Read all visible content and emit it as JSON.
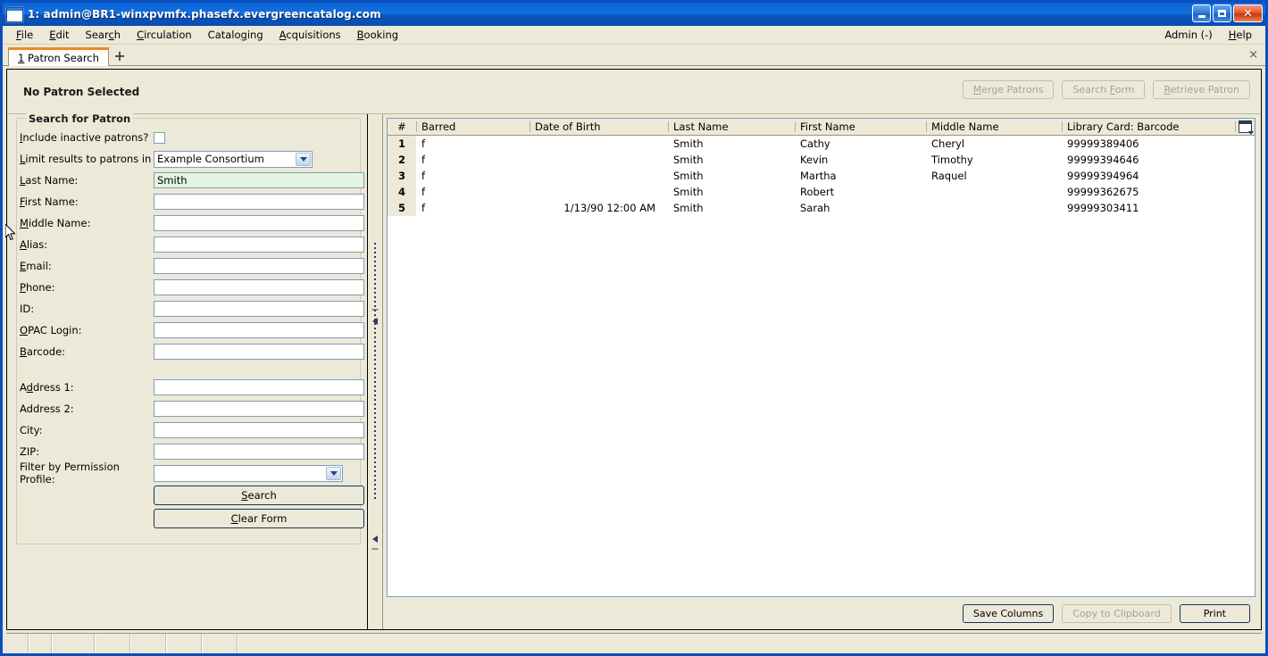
{
  "window": {
    "title": "1: admin@BR1-winxpvmfx.phasefx.evergreencatalog.com",
    "icon": "window-icon",
    "controls": {
      "minimize": "minimize",
      "maximize": "maximize",
      "close": "close"
    }
  },
  "menubar": {
    "items": [
      {
        "label": "File",
        "accel": "F"
      },
      {
        "label": "Edit",
        "accel": "E"
      },
      {
        "label": "Search",
        "accel": "c"
      },
      {
        "label": "Circulation",
        "accel": "C"
      },
      {
        "label": "Cataloging",
        "accel": "g"
      },
      {
        "label": "Acquisitions",
        "accel": "A"
      },
      {
        "label": "Booking",
        "accel": "B"
      }
    ],
    "right": [
      {
        "label": "Admin (-)",
        "accel": ""
      },
      {
        "label": "Help",
        "accel": "H"
      }
    ]
  },
  "tabbar": {
    "tabs": [
      {
        "number": "1",
        "label": "Patron Search",
        "active": true
      }
    ],
    "new_tab_label": "+",
    "close_label": "×"
  },
  "patron_header": {
    "title": "No Patron Selected",
    "buttons": [
      {
        "label": "Merge Patrons",
        "accel": "M",
        "disabled": true
      },
      {
        "label": "Search Form",
        "accel": "F",
        "disabled": true
      },
      {
        "label": "Retrieve Patron",
        "accel": "R",
        "disabled": true
      }
    ]
  },
  "search_form": {
    "legend": "Search for Patron",
    "fields": [
      {
        "name": "include-inactive",
        "label": "Include inactive patrons?",
        "accel": "I",
        "type": "checkbox",
        "checked": false
      },
      {
        "name": "limit-org",
        "label": "Limit results to patrons in",
        "accel": "L",
        "type": "select",
        "value": "Example Consortium"
      },
      {
        "name": "last-name",
        "label": "Last Name:",
        "accel": "L",
        "type": "text",
        "value": "Smith",
        "focused": true
      },
      {
        "name": "first-name",
        "label": "First Name:",
        "accel": "F",
        "type": "text",
        "value": ""
      },
      {
        "name": "middle-name",
        "label": "Middle Name:",
        "accel": "M",
        "type": "text",
        "value": ""
      },
      {
        "name": "alias",
        "label": "Alias:",
        "accel": "A",
        "type": "text",
        "value": ""
      },
      {
        "name": "email",
        "label": "Email:",
        "accel": "E",
        "type": "text",
        "value": ""
      },
      {
        "name": "phone",
        "label": "Phone:",
        "accel": "P",
        "type": "text",
        "value": ""
      },
      {
        "name": "id",
        "label": "ID:",
        "accel": "",
        "type": "text",
        "value": ""
      },
      {
        "name": "opac-login",
        "label": "OPAC Login:",
        "accel": "O",
        "type": "text",
        "value": ""
      },
      {
        "name": "barcode",
        "label": "Barcode:",
        "accel": "B",
        "type": "text",
        "value": ""
      },
      {
        "name": "address-1",
        "label": "Address 1:",
        "accel": "d",
        "type": "text",
        "value": "",
        "spaced": true
      },
      {
        "name": "address-2",
        "label": "Address 2:",
        "accel": "",
        "type": "text",
        "value": ""
      },
      {
        "name": "city",
        "label": "City:",
        "accel": "",
        "type": "text",
        "value": ""
      },
      {
        "name": "zip",
        "label": "ZIP:",
        "accel": "",
        "type": "text",
        "value": ""
      },
      {
        "name": "permission-profile",
        "label": "Filter by Permission Profile:",
        "accel": "",
        "type": "select",
        "value": ""
      }
    ],
    "buttons": [
      {
        "name": "search-button",
        "label": "Search",
        "accel": "S"
      },
      {
        "name": "clear-form-button",
        "label": "Clear Form",
        "accel": "C"
      }
    ]
  },
  "results": {
    "columns": [
      {
        "key": "num",
        "label": "#"
      },
      {
        "key": "barred",
        "label": "Barred"
      },
      {
        "key": "dob",
        "label": "Date of Birth"
      },
      {
        "key": "last_name",
        "label": "Last Name"
      },
      {
        "key": "first_name",
        "label": "First Name"
      },
      {
        "key": "middle_name",
        "label": "Middle Name"
      },
      {
        "key": "barcode",
        "label": "Library Card: Barcode"
      }
    ],
    "column_picker_icon": "column-picker-icon",
    "rows": [
      {
        "num": "1",
        "barred": "f",
        "dob": "",
        "last_name": "Smith",
        "first_name": "Cathy",
        "middle_name": "Cheryl",
        "barcode": "99999389406"
      },
      {
        "num": "2",
        "barred": "f",
        "dob": "",
        "last_name": "Smith",
        "first_name": "Kevin",
        "middle_name": "Timothy",
        "barcode": "99999394646"
      },
      {
        "num": "3",
        "barred": "f",
        "dob": "",
        "last_name": "Smith",
        "first_name": "Martha",
        "middle_name": "Raquel",
        "barcode": "99999394964"
      },
      {
        "num": "4",
        "barred": "f",
        "dob": "",
        "last_name": "Smith",
        "first_name": "Robert",
        "middle_name": "",
        "barcode": "99999362675"
      },
      {
        "num": "5",
        "barred": "f",
        "dob": "1/13/90 12:00 AM",
        "last_name": "Smith",
        "first_name": "Sarah",
        "middle_name": "",
        "barcode": "99999303411"
      }
    ],
    "footer_buttons": [
      {
        "name": "save-columns-button",
        "label": "Save Columns",
        "disabled": false
      },
      {
        "name": "copy-to-clipboard-button",
        "label": "Copy to Clipboard",
        "disabled": true
      },
      {
        "name": "print-button",
        "label": "Print",
        "disabled": false
      }
    ]
  },
  "statusbar": {
    "cells": [
      "",
      "",
      "",
      "",
      "",
      "",
      "",
      ""
    ]
  },
  "colors": {
    "titlebar_blue": "#0a62d0",
    "chrome_beige": "#ece9d8",
    "active_tab_accent": "#f08a1e",
    "field_border": "#7f9db9",
    "focused_field_bg": "#e4f6e2",
    "button_border": "#17365c"
  }
}
